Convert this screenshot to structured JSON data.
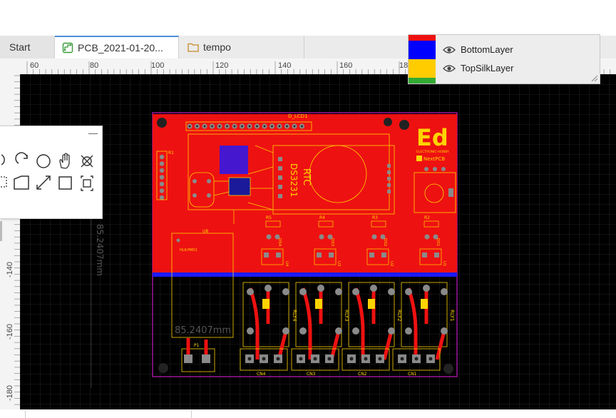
{
  "tabs": [
    {
      "label": "Start",
      "icon": "none",
      "active": false
    },
    {
      "label": "PCB_2021-01-20...",
      "icon": "pcb-document-icon",
      "active": true
    },
    {
      "label": "tempo",
      "icon": "folder-icon",
      "active": false
    }
  ],
  "ruler_top": {
    "labels": [
      "60",
      "80",
      "100",
      "120",
      "140",
      "160",
      "18"
    ]
  },
  "ruler_left": {
    "labels": [
      "-140",
      "-160",
      "-180"
    ]
  },
  "layers": [
    {
      "name": "BottomLayer",
      "color": "#0000ff"
    },
    {
      "name": "TopSilkLayer",
      "color": "#ffcc00"
    }
  ],
  "tools_panel": {
    "minimize_label": "—",
    "tools": [
      "arc-icon",
      "rotate-icon",
      "circle-icon",
      "hand-pan-icon",
      "cross-select-icon",
      "box-select-icon",
      "polygon-icon",
      "dimension-icon",
      "rectangle-icon",
      "fit-view-icon"
    ]
  },
  "pcb": {
    "silk_labels": {
      "lcd": "D_LCD1",
      "rtc": "RTC",
      "rtc_chip": "DS3231",
      "brand_logo": "Ed",
      "brand_sub1": "ELECTRONIC-HOBBY",
      "brand_sub2": "NextPCB",
      "u8": "U8",
      "power_module": "HLK-PM01",
      "dimension": "85.2407mm",
      "relay1": "RLY1",
      "relay2": "RLY2",
      "relay3": "RLY3",
      "relay4": "RLY4",
      "cn1": "CN1",
      "cn2": "CN2",
      "cn3": "CN3",
      "cn4": "CN4",
      "p1": "P1",
      "r1": "R1",
      "r2": "R2",
      "r3": "R3",
      "r4": "R4",
      "r5": "R5",
      "ds1": "DS1",
      "ds2": "DS2",
      "ds3": "DS3",
      "ds4": "DS4",
      "u1": "U1",
      "u2": "U2",
      "u3": "U3",
      "u4": "U4"
    }
  },
  "colors": {
    "board_fill": "#ee1111",
    "silkscreen": "#ffd400",
    "bottom_layer": "#0000ff",
    "board_outline": "#c01ac0",
    "pad": "#8a8a8a",
    "canvas_bg": "#000000",
    "grid": "#2c2c2c"
  }
}
